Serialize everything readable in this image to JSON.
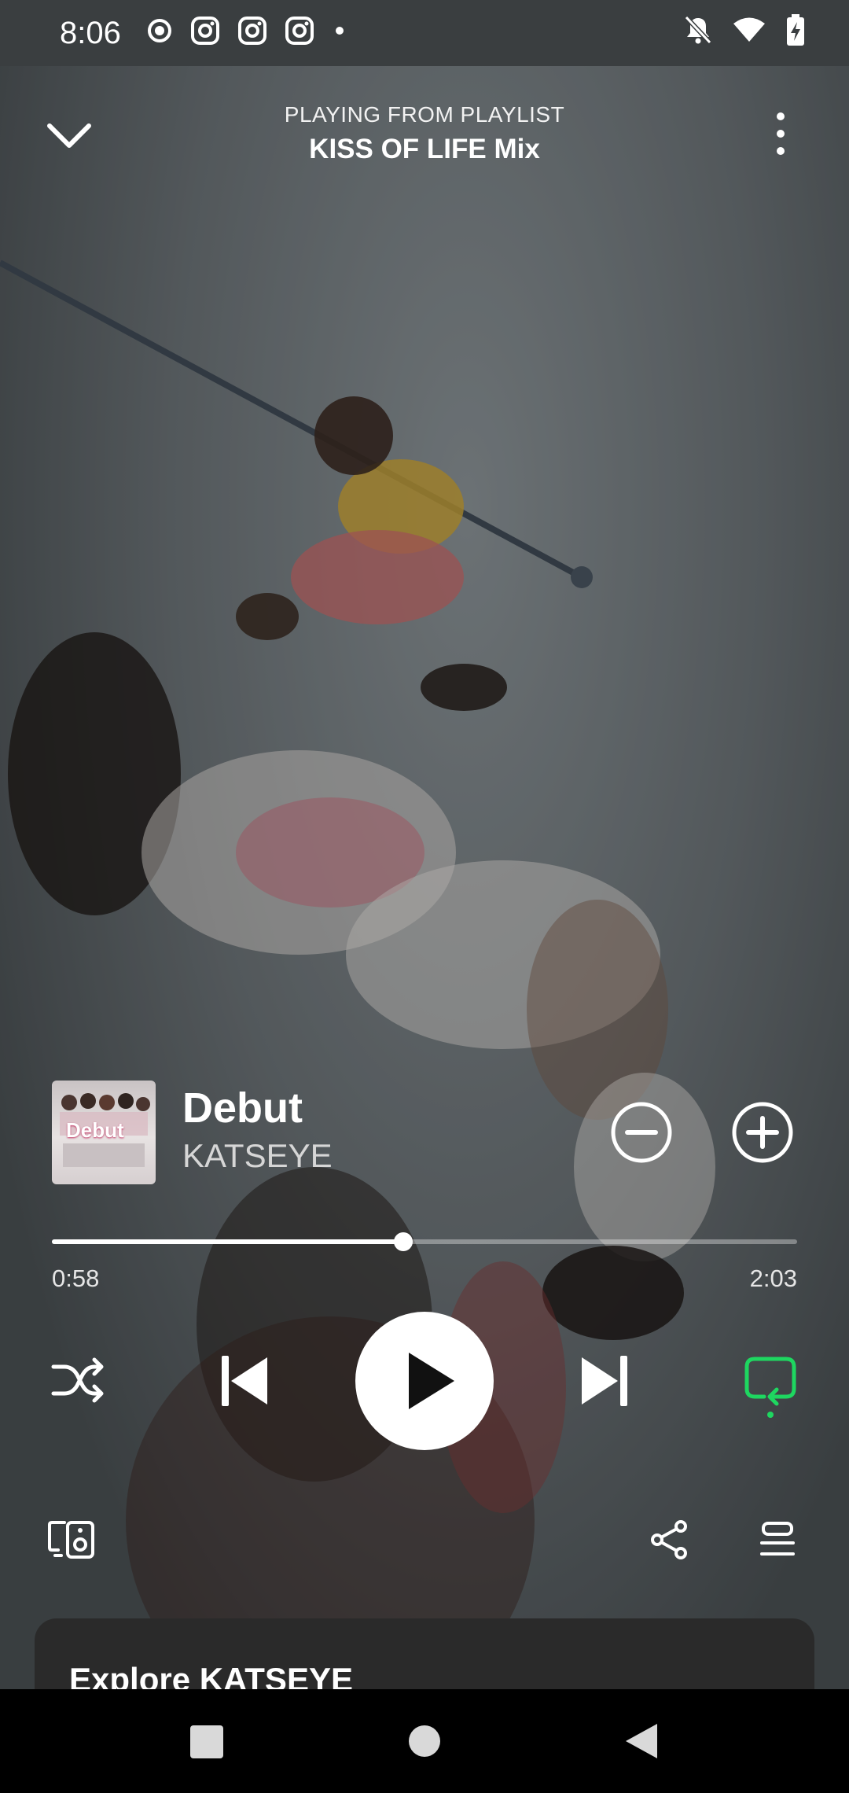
{
  "status_bar": {
    "time": "8:06",
    "left_icons": [
      "record-icon",
      "instagram-icon",
      "instagram-icon",
      "instagram-icon",
      "dot-icon"
    ],
    "right_icons": [
      "bell-off-icon",
      "wifi-icon",
      "battery-charging-icon"
    ]
  },
  "header": {
    "subtitle": "PLAYING FROM PLAYLIST",
    "title": "KISS OF LIFE Mix"
  },
  "track": {
    "album_text": "Debut",
    "title": "Debut",
    "artist": "KATSEYE"
  },
  "playback": {
    "current_time": "0:58",
    "total_time": "2:03",
    "progress_fraction": 0.472,
    "state": "paused",
    "repeat_active": true
  },
  "explore": {
    "title": "Explore KATSEYE"
  },
  "colors": {
    "accent_green": "#1ed760",
    "background": "#5f6669",
    "card": "#2a2a2a"
  }
}
